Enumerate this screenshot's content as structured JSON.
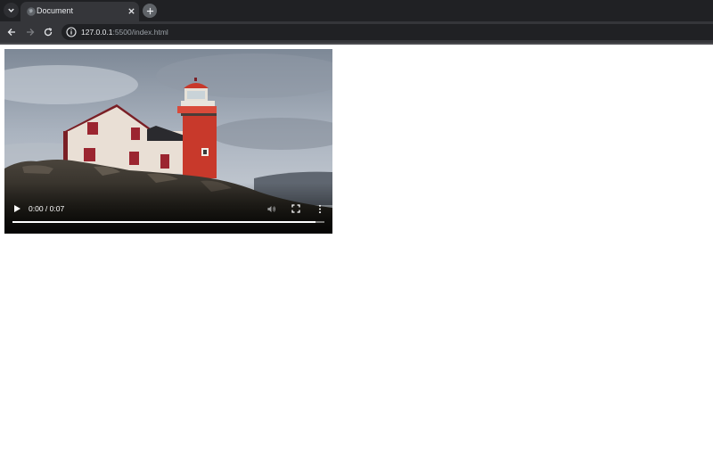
{
  "tab": {
    "title": "Document"
  },
  "address_bar": {
    "host": "127.0.0.1",
    "rest": ":5500/index.html"
  },
  "video": {
    "current_time": "0:00",
    "separator": "/",
    "duration": "0:07",
    "progress": 0.97
  },
  "colors": {
    "tabstrip_bg": "#202124",
    "toolbar_bg": "#35363a",
    "lighthouse_red": "#c8392b"
  }
}
